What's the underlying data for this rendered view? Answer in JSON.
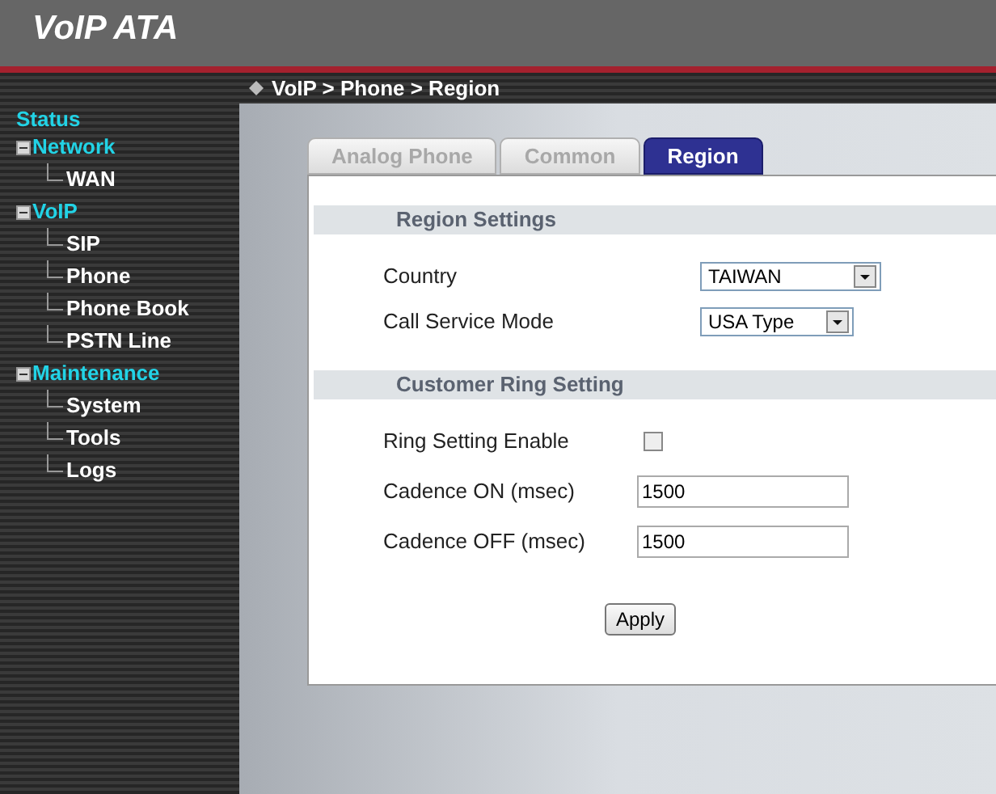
{
  "header": {
    "title": "VoIP ATA"
  },
  "breadcrumb": "VoIP > Phone > Region",
  "sidebar": {
    "root": "Status",
    "groups": [
      {
        "label": "Network",
        "expanded": true,
        "children": [
          {
            "label": "WAN"
          }
        ]
      },
      {
        "label": "VoIP",
        "expanded": true,
        "children": [
          {
            "label": "SIP"
          },
          {
            "label": "Phone"
          },
          {
            "label": "Phone Book"
          },
          {
            "label": "PSTN Line"
          }
        ]
      },
      {
        "label": "Maintenance",
        "expanded": true,
        "children": [
          {
            "label": "System"
          },
          {
            "label": "Tools"
          },
          {
            "label": "Logs"
          }
        ]
      }
    ]
  },
  "tabs": [
    {
      "label": "Analog Phone",
      "selected": false
    },
    {
      "label": "Common",
      "selected": false
    },
    {
      "label": "Region",
      "selected": true
    }
  ],
  "sections": [
    {
      "title": "Region Settings",
      "fields": [
        {
          "kind": "select",
          "label": "Country",
          "value": "TAIWAN"
        },
        {
          "kind": "select",
          "label": "Call Service Mode",
          "value": "USA Type"
        }
      ]
    },
    {
      "title": "Customer Ring Setting",
      "fields": [
        {
          "kind": "checkbox",
          "label": "Ring Setting Enable",
          "checked": false
        },
        {
          "kind": "text",
          "label": "Cadence ON (msec)",
          "value": "1500"
        },
        {
          "kind": "text",
          "label": "Cadence OFF (msec)",
          "value": "1500"
        }
      ]
    }
  ],
  "apply_button": "Apply"
}
